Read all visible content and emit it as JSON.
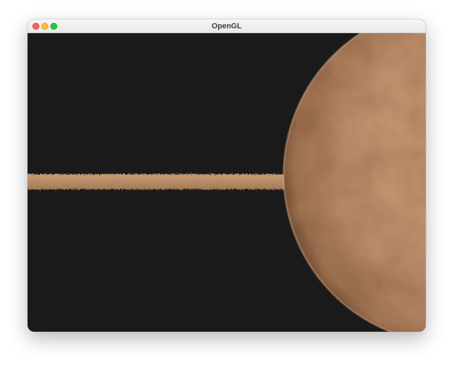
{
  "window": {
    "title": "OpenGL"
  },
  "icons": {
    "close": "close-icon",
    "minimize": "minimize-icon",
    "maximize": "maximize-icon"
  },
  "colors": {
    "background": "#1a1a1a",
    "planet": "#c89a72",
    "ring": "#b98d68",
    "close": "#fe5f57",
    "minimize": "#febc2e",
    "maximize": "#28c840"
  }
}
